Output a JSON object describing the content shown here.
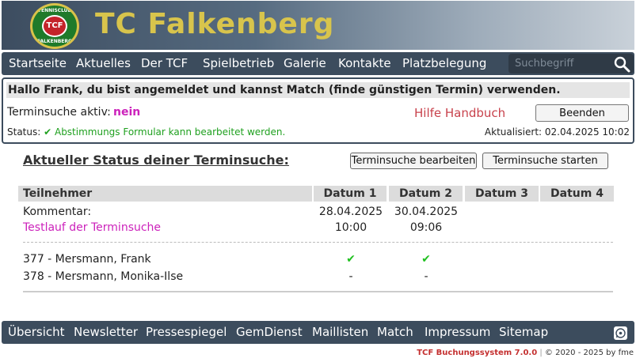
{
  "header": {
    "site_title": "TC Falkenberg",
    "logo_top": "TENNISCLUB",
    "logo_center": "TCF",
    "logo_bottom": "FALKENBERG",
    "brand_color": "#d8c44c"
  },
  "nav": {
    "items": [
      "Startseite",
      "Aktuelles",
      "Der TCF",
      "Spielbetrieb",
      "Galerie",
      "Kontakte",
      "Platzbelegung"
    ],
    "search_placeholder": "Suchbegriff",
    "search_icon": "search-icon"
  },
  "info": {
    "greeting": "Hallo Frank, du bist angemeldet und kannst Match (finde günstigen Termin) verwenden.",
    "search_active_label": "Terminsuche aktiv:",
    "search_active_value": "nein",
    "help_link": "Hilfe Handbuch",
    "end_button": "Beenden",
    "status_label": "Status:",
    "status_text": "✔ Abstimmungs Formular kann bearbeitet werden.",
    "updated_label": "Aktualisiert:",
    "updated_value": "02.04.2025 10:02"
  },
  "status_section": {
    "title": "Aktueller Status deiner Terminsuche:",
    "edit_button": "Terminsuche bearbeiten",
    "start_button": "Terminsuche starten"
  },
  "table": {
    "headers": [
      "Teilnehmer",
      "Datum 1",
      "Datum 2",
      "Datum 3",
      "Datum 4"
    ],
    "comment_label": "Kommentar:",
    "comment_text": "Testlauf der Terminsuche",
    "dates": [
      {
        "date": "28.04.2025",
        "time": "10:00"
      },
      {
        "date": "30.04.2025",
        "time": "09:06"
      }
    ],
    "rows": [
      {
        "name": "377 - Mersmann, Frank",
        "d1": "✔",
        "d2": "✔"
      },
      {
        "name": "378 - Mersmann, Monika-Ilse",
        "d1": "-",
        "d2": "-"
      }
    ]
  },
  "footer": {
    "items": [
      "Übersicht",
      "Newsletter",
      "Pressespiegel",
      "GemDienst",
      "Maillisten",
      "Match",
      "Impressum",
      "Sitemap"
    ],
    "system": "TCF Buchungssystem 7.0.0",
    "copyright": "© 2020 - 2025 by fme"
  }
}
